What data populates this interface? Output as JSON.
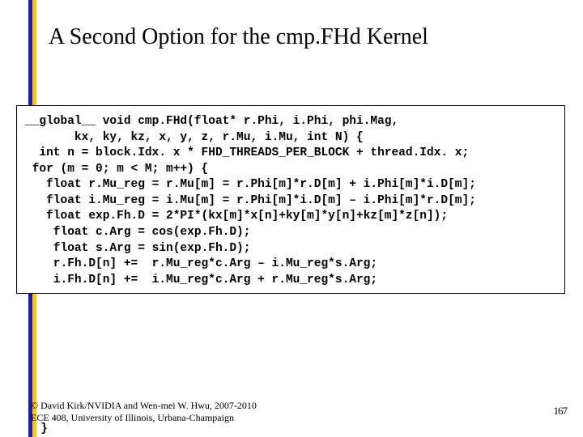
{
  "slide": {
    "title": "A Second Option for the cmp.FHd Kernel",
    "code": {
      "l0": "__global__ void cmp.FHd(float* r.Phi, i.Phi, phi.Mag,",
      "l1": "       kx, ky, kz, x, y, z, r.Mu, i.Mu, int N) {",
      "l2": "",
      "l3": "  int n = block.Idx. x * FHD_THREADS_PER_BLOCK + thread.Idx. x;",
      "l4": "",
      "l5": " for (m = 0; m < M; m++) {",
      "l6": "",
      "l7": "   float r.Mu_reg = r.Mu[m] = r.Phi[m]*r.D[m] + i.Phi[m]*i.D[m];",
      "l8": "   float i.Mu_reg = i.Mu[m] = r.Phi[m]*i.D[m] – i.Phi[m]*r.D[m];",
      "l9": "",
      "l10": "   float exp.Fh.D = 2*PI*(kx[m]*x[n]+ky[m]*y[n]+kz[m]*z[n]);",
      "l11": "",
      "l12": "    float c.Arg = cos(exp.Fh.D);",
      "l13": "    float s.Arg = sin(exp.Fh.D);",
      "l14": "",
      "l15": "    r.Fh.D[n] +=  r.Mu_reg*c.Arg – i.Mu_reg*s.Arg;",
      "l16": "    i.Fh.D[n] +=  i.Mu_reg*c.Arg + r.Mu_reg*s.Arg;"
    },
    "trailing_brace": "  }",
    "footer_line1": "© David Kirk/NVIDIA and Wen-mei W. Hwu, 2007-2010",
    "footer_line2": "ECE 408, University of Illinois, Urbana-Champaign",
    "page_number": "167"
  }
}
